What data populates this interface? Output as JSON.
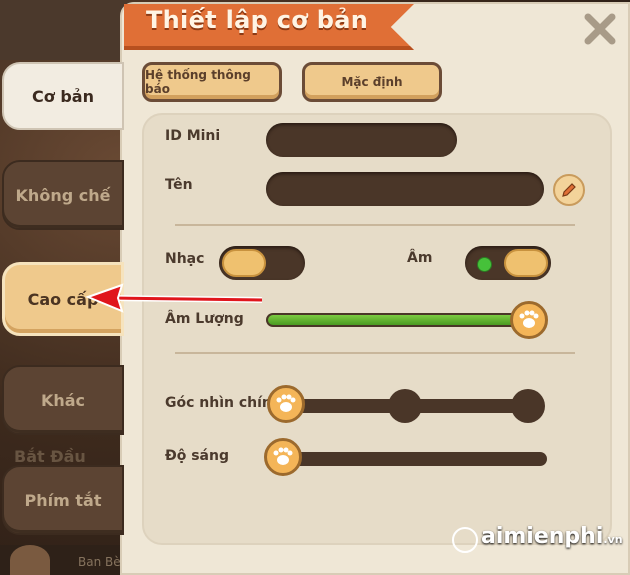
{
  "page": {
    "title": "Thiết lập cơ bản"
  },
  "tabs": [
    {
      "label": "Cơ bản",
      "state": "active"
    },
    {
      "label": "Không chế",
      "state": "inactive"
    },
    {
      "label": "Cao cấp",
      "state": "selected"
    },
    {
      "label": "Khác",
      "state": "inactive"
    },
    {
      "label": "Phím tắt",
      "state": "inactive"
    }
  ],
  "background": {
    "faded_text": "Bắt Đầu",
    "faded_text_2": "Ban Bè"
  },
  "top_buttons": {
    "notification_label": "Hệ thống thông báo",
    "default_label": "Mặc định"
  },
  "fields": {
    "id_label": "ID Mini",
    "id_value": "",
    "name_label": "Tên",
    "name_value": ""
  },
  "audio": {
    "music_label": "Nhạc",
    "music_on": false,
    "sound_label": "Âm",
    "sound_on": true,
    "volume_label": "Âm Lượng",
    "volume_level": 0.94
  },
  "camera": {
    "label": "Góc nhìn chính",
    "steps": 3,
    "selected_index": 0
  },
  "brightness": {
    "label": "Độ sáng",
    "level": 0.0
  },
  "colors": {
    "accent_orange": "#e06f36",
    "knob_gold": "#f4b558",
    "slider_green": "#5fb330",
    "dark_track": "#4a3628",
    "panel_bg": "#efe7d6"
  },
  "icons": {
    "close": "close-icon",
    "edit": "pencil-icon",
    "paw": "paw-icon",
    "arrow": "red-arrow-annotation"
  },
  "watermark": {
    "brand": "aimienphi",
    "suffix": ".vn"
  }
}
